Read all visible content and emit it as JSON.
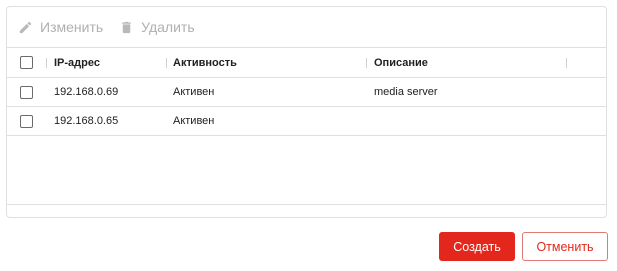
{
  "toolbar": {
    "edit_label": "Изменить",
    "edit_icon": "pencil-icon",
    "delete_label": "Удалить",
    "delete_icon": "trash-icon"
  },
  "table": {
    "columns": [
      "IP-адрес",
      "Активность",
      "Описание"
    ],
    "rows": [
      {
        "ip": "192.168.0.69",
        "activity": "Активен",
        "description": "media server"
      },
      {
        "ip": "192.168.0.65",
        "activity": "Активен",
        "description": ""
      }
    ]
  },
  "footer": {
    "create_label": "Создать",
    "cancel_label": "Отменить"
  },
  "colors": {
    "accent": "#e4271c",
    "disabled": "#b0b0b0"
  }
}
